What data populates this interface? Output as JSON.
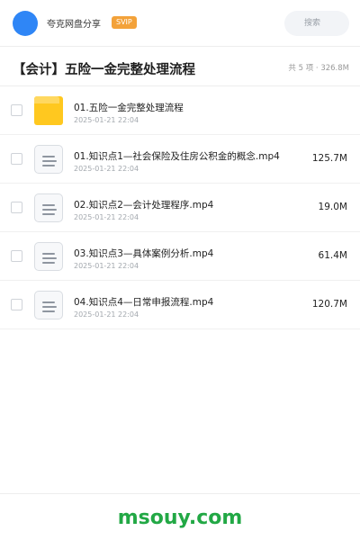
{
  "header": {
    "username": "夸克网盘分享",
    "badge": "SVIP",
    "search_placeholder": "搜索"
  },
  "folder": {
    "title": "【会计】五险一金完整处理流程",
    "meta": "共 5 项 · 326.8M"
  },
  "files": [
    {
      "type": "folder",
      "name": "01.五险一金完整处理流程",
      "date": "2025-01-21 22:04",
      "size": ""
    },
    {
      "type": "file",
      "name": "01.知识点1—社会保险及住房公积金的概念.mp4",
      "date": "2025-01-21 22:04",
      "size": "125.7M"
    },
    {
      "type": "file",
      "name": "02.知识点2—会计处理程序.mp4",
      "date": "2025-01-21 22:04",
      "size": "19.0M"
    },
    {
      "type": "file",
      "name": "03.知识点3—具体案例分析.mp4",
      "date": "2025-01-21 22:04",
      "size": "61.4M"
    },
    {
      "type": "file",
      "name": "04.知识点4—日常申报流程.mp4",
      "date": "2025-01-21 22:04",
      "size": "120.7M"
    }
  ],
  "footer": {
    "watermark": "msouy.com"
  },
  "colors": {
    "avatar": "#2f86f6",
    "badge": "#f3a23a",
    "folder": "#ffc81f",
    "watermark": "#22a845"
  },
  "icons": {
    "folder": "folder-icon",
    "file": "document-icon"
  }
}
